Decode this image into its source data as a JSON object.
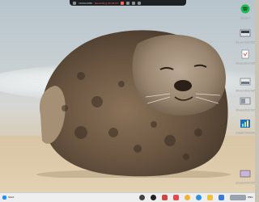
{
  "topbar": {
    "resolution": "1920x1080",
    "recording": "Recording 00:02:07"
  },
  "desktop": {
    "icons": [
      {
        "name": "spotify-icon",
        "label": "Spotify"
      },
      {
        "name": "screenshot-file-icon",
        "label": "Screenshot 2024-08-08..."
      },
      {
        "name": "screenshot-file-icon-2",
        "label": "Screenshot 2024-08-08..."
      },
      {
        "name": "screenshot-file-icon-3",
        "label": "Screenshot 2024-08-08..."
      },
      {
        "name": "screenshot-file-icon-4",
        "label": "Screenshot 2024-08-08..."
      },
      {
        "name": "charts-icon",
        "label": "Charts Videotut..."
      },
      {
        "name": "screenshot-file-icon-5",
        "label": "Screenshot 2024-08-08..."
      }
    ]
  },
  "taskbar": {
    "start_label": "Start",
    "apps": [
      "search",
      "obs",
      "media",
      "files",
      "chrome",
      "edge",
      "explorer",
      "store",
      "settings"
    ],
    "tray_label": "ENG"
  },
  "colors": {
    "taskbar_bg": "#eeeeee",
    "topbar_bg": "#1f2024",
    "recording_red": "#ff6a5a"
  }
}
